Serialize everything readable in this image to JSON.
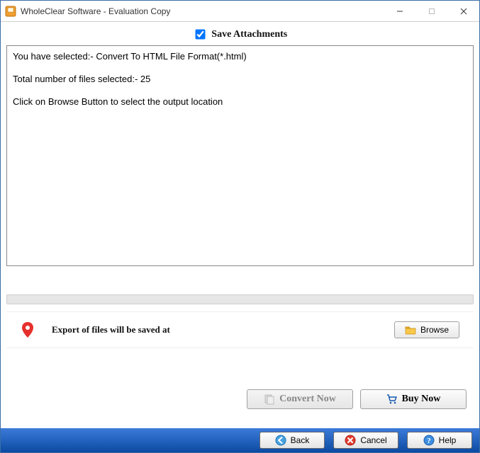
{
  "window": {
    "title": "WholeClear Software - Evaluation Copy"
  },
  "checkbox": {
    "save_attachments_label": "Save Attachments",
    "save_attachments_checked": true
  },
  "log": {
    "line1": "You have selected:- Convert To HTML File Format(*.html)",
    "line2": "Total number of files selected:- 25",
    "line3": "Click on Browse Button to select the output location"
  },
  "export": {
    "label": "Export of files will be saved at",
    "browse_label": "Browse"
  },
  "buttons": {
    "convert_now": "Convert Now",
    "buy_now": "Buy Now"
  },
  "footer": {
    "back": "Back",
    "cancel": "Cancel",
    "help": "Help"
  }
}
